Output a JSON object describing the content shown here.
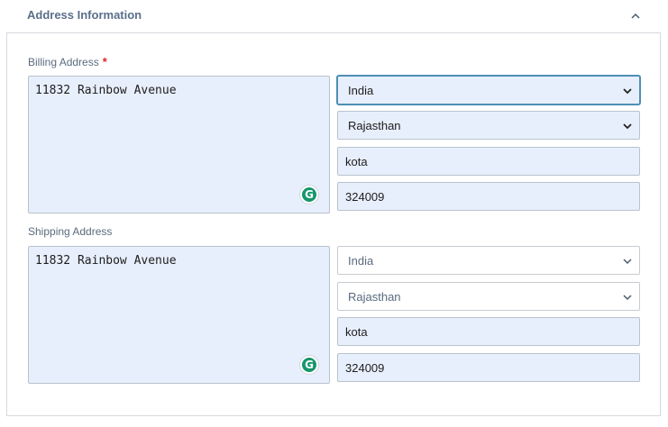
{
  "section": {
    "title": "Address Information"
  },
  "billing": {
    "label": "Billing Address",
    "required_mark": "*",
    "address": "11832 Rainbow Avenue",
    "country": "India",
    "state": "Rajasthan",
    "city": "kota",
    "zip": "324009"
  },
  "shipping": {
    "label": "Shipping Address",
    "address": "11832 Rainbow Avenue",
    "country": "India",
    "state": "Rajasthan",
    "city": "kota",
    "zip": "324009"
  },
  "icons": {
    "collapse": "chevron-up-icon",
    "grammarly": "grammarly-icon",
    "dropdown": "chevron-down-icon"
  },
  "grammarly_letter": "G",
  "colors": {
    "accent": "#4d8fb5",
    "field_bg": "#e8effc",
    "required": "#e02424",
    "grammarly": "#15966b"
  }
}
